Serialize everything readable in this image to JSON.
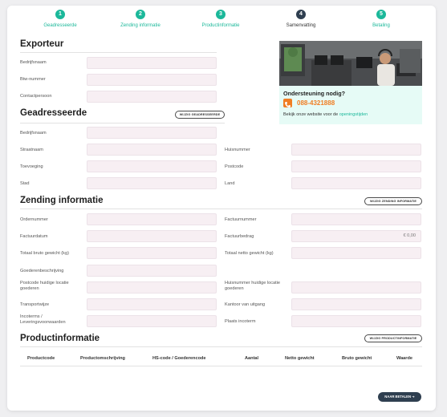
{
  "steps": [
    {
      "num": "1",
      "label": "Geadresseerde"
    },
    {
      "num": "2",
      "label": "Zending informatie"
    },
    {
      "num": "3",
      "label": "Productinformatie"
    },
    {
      "num": "4",
      "label": "Samenvatting"
    },
    {
      "num": "5",
      "label": "Betaling"
    }
  ],
  "exporteur": {
    "title": "Exporteur",
    "fields": [
      "Bedrijfsnaam",
      "Btw-nummer",
      "Contactpersoon"
    ]
  },
  "support": {
    "title": "Ondersteuning nodig?",
    "phone": "088-4321888",
    "hint_text": "Bekijk onze website voor de ",
    "hint_link": "openingstijden"
  },
  "geadresseerde": {
    "title": "Geadresseerde",
    "edit_button": "WIJZIG GEADRESSEERDE",
    "left_fields": [
      "Bedrijfsnaam",
      "Straatnaam",
      "Toevoeging",
      "Stad"
    ],
    "right_fields": [
      "Huisnummer",
      "Postcode",
      "Land"
    ]
  },
  "zending": {
    "title": "Zending informatie",
    "edit_button": "WIJZIG ZENDING INFORMATIE",
    "left_fields": [
      "Ordernummer",
      "Factuurdatum",
      "Totaal bruto gewicht (kg)",
      "Goederenbeschrijving",
      "Postcode huidige locatie goederen",
      "Transportwijze",
      "Incoterms / Leveringsvoorwaarden"
    ],
    "right_fields": [
      "Factuurnummer",
      "Factuurbedrag",
      "Totaal netto gewicht (kg)",
      "Huisnummer huidige locatie goederen",
      "Kantoor van uitgang",
      "Plaats incoterm"
    ],
    "factuurbedrag_value": "€ 0,00"
  },
  "product": {
    "title": "Productinformatie",
    "edit_button": "WIJZIG PRODUCTINFORMATIE",
    "columns": [
      "Productcode",
      "Productomschrijving",
      "HS-code / Goederencode",
      "Aantal",
      "Netto gewicht",
      "Bruto gewicht",
      "Waarde"
    ]
  },
  "next_button": "NAAR BETALEN"
}
